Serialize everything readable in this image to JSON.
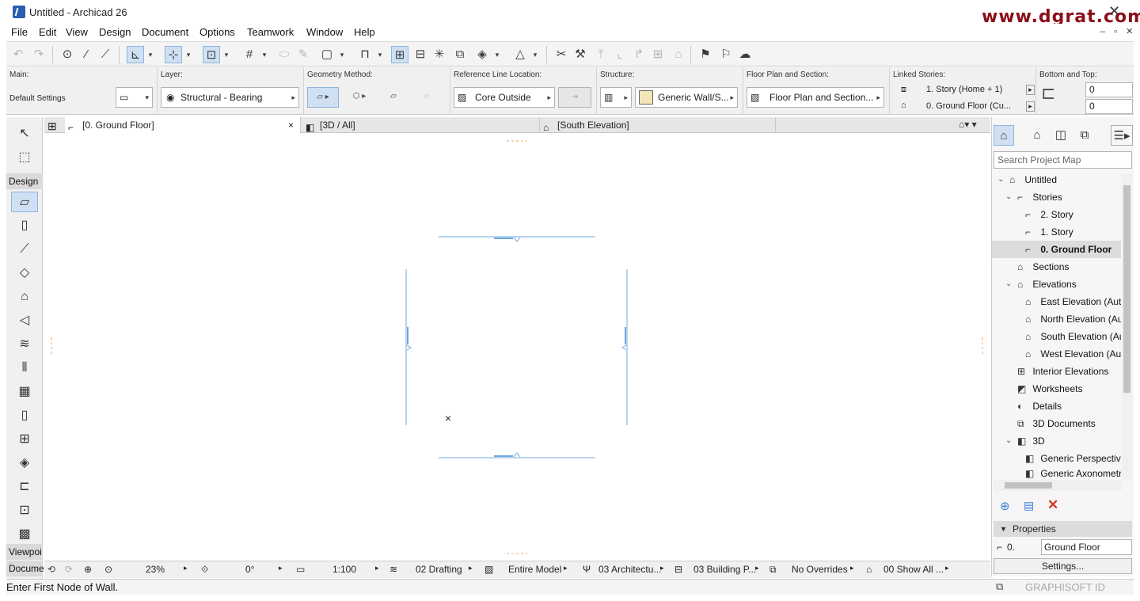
{
  "window": {
    "title": "Untitled - Archicad 26",
    "watermark": "www.dgrat.com"
  },
  "menu": [
    "File",
    "Edit",
    "View",
    "Design",
    "Document",
    "Options",
    "Teamwork",
    "Window",
    "Help"
  ],
  "infobox": {
    "main_label": "Main:",
    "main_value": "Default Settings",
    "layer_label": "Layer:",
    "layer_value": "Structural - Bearing",
    "geometry_label": "Geometry Method:",
    "refline_label": "Reference Line Location:",
    "refline_value": "Core Outside",
    "structure_label": "Structure:",
    "structure_value": "Generic Wall/S...",
    "floorplan_label": "Floor Plan and Section:",
    "floorplan_value": "Floor Plan and Section...",
    "linked_label": "Linked Stories:",
    "linked_top": "1. Story (Home + 1)",
    "linked_bottom": "0. Ground Floor (Cu...",
    "bt_label": "Bottom and Top:",
    "top_value": "0",
    "bottom_value": "0"
  },
  "toolbox": {
    "design_label": "Design",
    "viewpoint_label": "Viewpoi",
    "document_label": "Docume"
  },
  "tabs": [
    {
      "label": "[0. Ground Floor]",
      "close": "×"
    },
    {
      "label": "[3D / All]"
    },
    {
      "label": "[South Elevation]"
    }
  ],
  "canvas": {
    "marker": "×"
  },
  "status_row": {
    "zoom": "23%",
    "angle": "0°",
    "scale": "1:100",
    "layer_combo": "02 Drafting",
    "model_view": "Entire Model",
    "pen_set": "03 Architectu...",
    "mvo": "03 Building P...",
    "overrides": "No Overrides",
    "renovation": "00 Show All ..."
  },
  "prompt": "Enter First Node of Wall.",
  "brand": "GRAPHISOFT ID",
  "navigator": {
    "search_placeholder": "Search Project Map",
    "items": [
      {
        "label": "Untitled"
      },
      {
        "label": "Stories"
      },
      {
        "label": "2. Story"
      },
      {
        "label": "1. Story"
      },
      {
        "label": "0. Ground Floor"
      },
      {
        "label": "Sections"
      },
      {
        "label": "Elevations"
      },
      {
        "label": "East Elevation (Auto"
      },
      {
        "label": "North Elevation (Au"
      },
      {
        "label": "South Elevation (Au"
      },
      {
        "label": "West Elevation (Aut"
      },
      {
        "label": "Interior Elevations"
      },
      {
        "label": "Worksheets"
      },
      {
        "label": "Details"
      },
      {
        "label": "3D Documents"
      },
      {
        "label": "3D"
      },
      {
        "label": "Generic Perspective"
      },
      {
        "label": "Generic Axonometr"
      }
    ],
    "properties_label": "Properties",
    "prop_number": "0.",
    "prop_name": "Ground Floor",
    "settings_label": "Settings..."
  },
  "colors": {
    "wall_line": "#6fa8dc",
    "sel_bg": "#cfe0f3",
    "close_red": "#d9342b",
    "watermark": "#8b0f1a"
  }
}
